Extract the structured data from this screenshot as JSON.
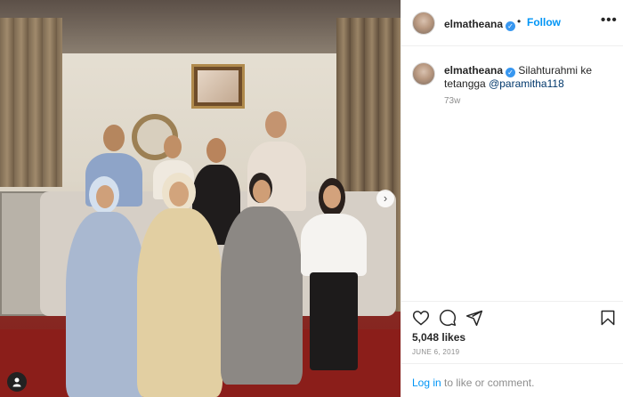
{
  "post": {
    "username": "elmatheana",
    "follow_label": "Follow",
    "dot": "•",
    "more_label": "•••",
    "verified_glyph": "✓"
  },
  "caption": {
    "username": "elmatheana",
    "text": "Silahturahmi ke tetangga",
    "mention": "@paramitha118",
    "time_ago": "73w"
  },
  "actions": {
    "like_icon": "heart-icon",
    "comment_icon": "comment-icon",
    "share_icon": "share-icon",
    "save_icon": "bookmark-icon"
  },
  "stats": {
    "likes": "5,048 likes",
    "date": "JUNE 6, 2019"
  },
  "login": {
    "link": "Log in",
    "rest": " to like or comment."
  },
  "photo": {
    "next_arrow": "›",
    "user_tag_glyph": "👤"
  },
  "colors": {
    "accent": "#0095f6",
    "verified": "#3897f0",
    "muted": "#8e8e8e",
    "text": "#262626"
  }
}
